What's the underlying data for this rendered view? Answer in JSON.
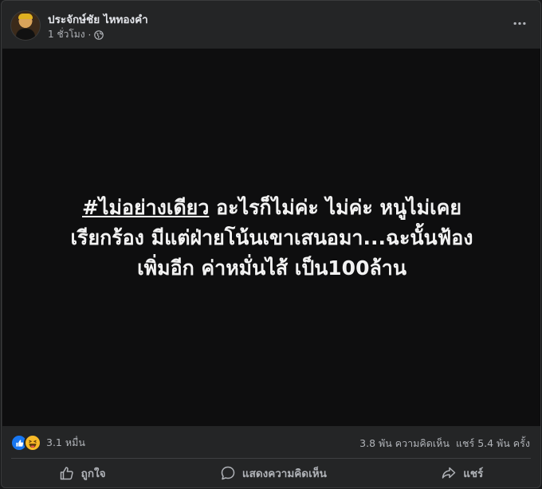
{
  "post": {
    "author": "ประจักษ์ชัย ไหทองคำ",
    "time": "1 ชั่วโมง",
    "separator": "·",
    "privacy_icon": "globe-icon",
    "more_icon": "more-horizontal-icon",
    "text_hashtag": "#ไม่อย่างเดียว",
    "text_line1_rest": " อะไรก็ไม่ค่ะ ไม่ค่ะ หนูไม่เคย",
    "text_line2": "เรียกร้อง มีแต่ฝ่ายโน้นเขาเสนอมา...ฉะนั้นฟ้อง",
    "text_line3": "เพิ่มอีก ค่าหมั่นไส้ เป็น100ล้าน"
  },
  "stats": {
    "reactions_count": "3.1 หมื่น",
    "reaction_icons": [
      "like-icon",
      "haha-icon"
    ],
    "comments": "3.8 พัน ความคิดเห็น",
    "shares": "แชร์ 5.4 พัน ครั้ง"
  },
  "actions": {
    "like": "ถูกใจ",
    "comment": "แสดงความคิดเห็น",
    "share": "แชร์"
  },
  "colors": {
    "card_bg": "#242526",
    "content_bg": "#0e0e0f",
    "like_blue": "#1877f2",
    "haha_yellow": "#f7b928",
    "secondary_text": "#b0b3b8"
  }
}
